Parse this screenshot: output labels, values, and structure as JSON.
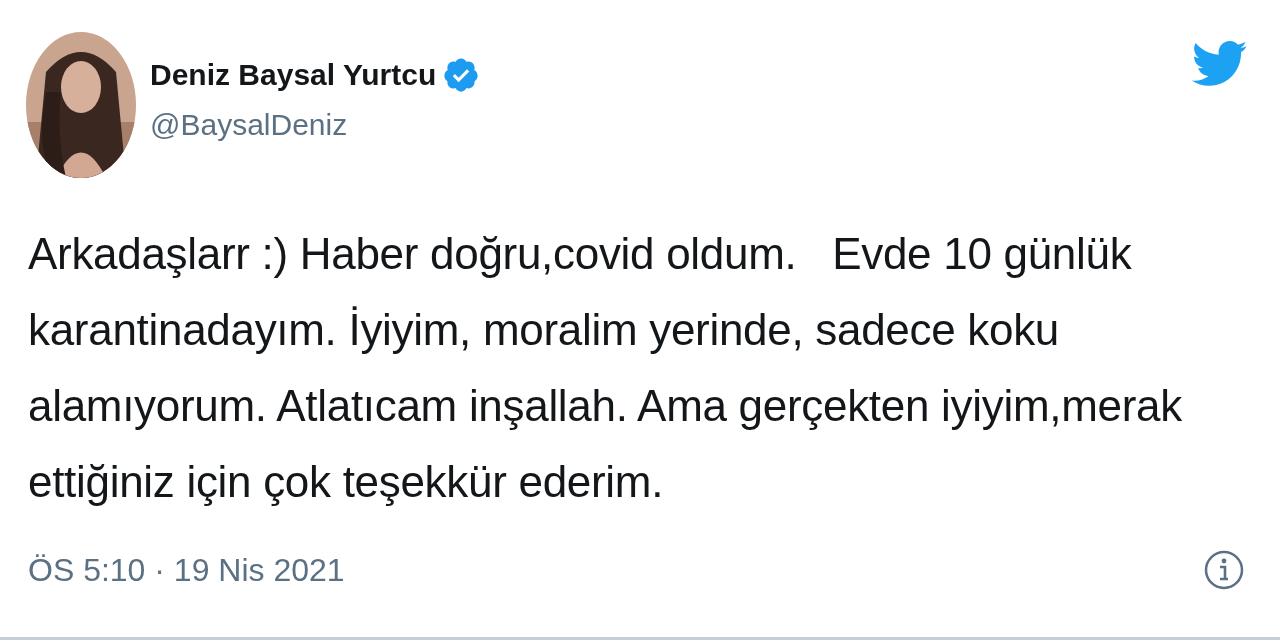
{
  "author": {
    "name": "Deniz Baysal Yurtcu",
    "handle": "@BaysalDeniz",
    "verified": true
  },
  "tweet": {
    "text": "Arkadaşlarr :) Haber doğru,covid oldum.   Evde 10 günlük\nkarantinadayım. İyiyim, moralim yerinde, sadece koku\nalamıyorum. Atlatıcam inşallah. Ama gerçekten iyiyim,merak\nettiğiniz için çok teşekkür ederim."
  },
  "footer": {
    "timestamp": "ÖS 5:10 · 19 Nis 2021"
  }
}
